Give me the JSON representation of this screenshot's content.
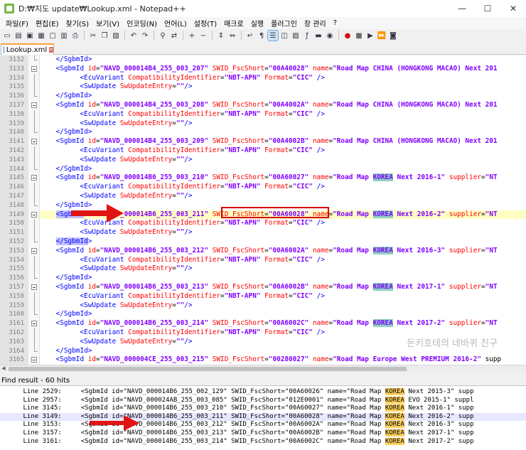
{
  "window": {
    "title": "D:₩지도 update₩Lookup.xml - Notepad++",
    "minimize": "—",
    "maximize": "☐",
    "close": "✕"
  },
  "menu": [
    "파일(F)",
    "편집(E)",
    "찾기(S)",
    "보기(V)",
    "인코딩(N)",
    "언어(L)",
    "설정(T)",
    "매크로",
    "실행",
    "플러그인",
    "창 관리",
    "?"
  ],
  "tab": {
    "label": "Lookup.xml"
  },
  "editor": {
    "lines": [
      {
        "n": "3132",
        "code": "    </SgbmId>"
      },
      {
        "n": "3133",
        "code": "    <SgbmId id=\"NAVD_000014B4_255_003_207\" SWID_FscShort=\"00A40028\" name=\"Road Map CHINA (HONGKONG MACAO) Next 201"
      },
      {
        "n": "3134",
        "code": "          <EcuVariant CompatibilityIdentifier=\"NBT-APN\" Format=\"CIC\" />"
      },
      {
        "n": "3135",
        "code": "          <SwUpdate SwUpdateEntry=\"\"/>"
      },
      {
        "n": "3136",
        "code": "    </SgbmId>"
      },
      {
        "n": "3137",
        "code": "    <SgbmId id=\"NAVD_000014B4_255_003_208\" SWID_FscShort=\"00A4002A\" name=\"Road Map CHINA (HONGKONG MACAO) Next 201"
      },
      {
        "n": "3138",
        "code": "          <EcuVariant CompatibilityIdentifier=\"NBT-APN\" Format=\"CIC\" />"
      },
      {
        "n": "3139",
        "code": "          <SwUpdate SwUpdateEntry=\"\"/>"
      },
      {
        "n": "3140",
        "code": "    </SgbmId>"
      },
      {
        "n": "3141",
        "code": "    <SgbmId id=\"NAVD_000014B4_255_003_209\" SWID_FscShort=\"00A4002B\" name=\"Road Map CHINA (HONGKONG MACAO) Next 201"
      },
      {
        "n": "3142",
        "code": "          <EcuVariant CompatibilityIdentifier=\"NBT-APN\" Format=\"CIC\" />"
      },
      {
        "n": "3143",
        "code": "          <SwUpdate SwUpdateEntry=\"\"/>"
      },
      {
        "n": "3144",
        "code": "    </SgbmId>"
      },
      {
        "n": "3145",
        "code": "    <SgbmId id=\"NAVD_000014B6_255_003_210\" SWID_FscShort=\"00A60027\" name=\"Road Map KOREA Next 2016-1\" supplier=\"NT"
      },
      {
        "n": "3146",
        "code": "          <EcuVariant CompatibilityIdentifier=\"NBT-APN\" Format=\"CIC\" />"
      },
      {
        "n": "3147",
        "code": "          <SwUpdate SwUpdateEntry=\"\"/>"
      },
      {
        "n": "3148",
        "code": "    </SgbmId>"
      },
      {
        "n": "3149",
        "code": "    <SgbmId id=\"NAVD_000014B6_255_003_211\" SWID_FscShort=\"00A60028\" name=\"Road Map KOREA Next 2016-2\" supplier=\"NT"
      },
      {
        "n": "3150",
        "code": "          <EcuVariant CompatibilityIdentifier=\"NBT-APN\" Format=\"CIC\" />"
      },
      {
        "n": "3151",
        "code": "          <SwUpdate SwUpdateEntry=\"\"/>"
      },
      {
        "n": "3152",
        "code": "    </SgbmId>"
      },
      {
        "n": "3153",
        "code": "    <SgbmId id=\"NAVD_000014B6_255_003_212\" SWID_FscShort=\"00A6002A\" name=\"Road Map KOREA Next 2016-3\" supplier=\"NT"
      },
      {
        "n": "3154",
        "code": "          <EcuVariant CompatibilityIdentifier=\"NBT-APN\" Format=\"CIC\" />"
      },
      {
        "n": "3155",
        "code": "          <SwUpdate SwUpdateEntry=\"\"/>"
      },
      {
        "n": "3156",
        "code": "    </SgbmId>"
      },
      {
        "n": "3157",
        "code": "    <SgbmId id=\"NAVD_000014B6_255_003_213\" SWID_FscShort=\"00A6002B\" name=\"Road Map KOREA Next 2017-1\" supplier=\"NT"
      },
      {
        "n": "3158",
        "code": "          <EcuVariant CompatibilityIdentifier=\"NBT-APN\" Format=\"CIC\" />"
      },
      {
        "n": "3159",
        "code": "          <SwUpdate SwUpdateEntry=\"\"/>"
      },
      {
        "n": "3160",
        "code": "    </SgbmId>"
      },
      {
        "n": "3161",
        "code": "    <SgbmId id=\"NAVD_000014B6_255_003_214\" SWID_FscShort=\"00A6002C\" name=\"Road Map KOREA Next 2017-2\" supplier=\"NT"
      },
      {
        "n": "3162",
        "code": "          <EcuVariant CompatibilityIdentifier=\"NBT-APN\" Format=\"CIC\" />"
      },
      {
        "n": "3163",
        "code": "          <SwUpdate SwUpdateEntry=\"\"/>"
      },
      {
        "n": "3164",
        "code": "    </SgbmId>"
      },
      {
        "n": "3165",
        "code": "    <SgbmId id=\"NAVD_000004CE_255_003_215\" SWID_FscShort=\"00280027\" name=\"Road Map Europe West PREMIUM 2016-2\" supp"
      }
    ],
    "current_line": "3149",
    "search_term": "KOREA"
  },
  "watermark": "돈키호테의 네바퀴 친구",
  "find": {
    "header": "Find result - 60 hits",
    "results": [
      {
        "label": "Line 2529:",
        "text": "<SgbmId id=\"NAVD_000014B6_255_002_129\" SWID_FscShort=\"00A60026\" name=\"Road Map KOREA Next 2015-3\" supp"
      },
      {
        "label": "Line 2957:",
        "text": "<SgbmId id=\"NAVD_000024AB_255_003_085\" SWID_FscShort=\"012E0001\" name=\"Road Map KOREA EVO 2015-1\" suppl"
      },
      {
        "label": "Line 3145:",
        "text": "<SgbmId id=\"NAVD_000014B6_255_003_210\" SWID_FscShort=\"00A60027\" name=\"Road Map KOREA Next 2016-1\" supp"
      },
      {
        "label": "Line 3149:",
        "text": "<SgbmId id=\"NAVD_000014B6_255_003_211\" SWID_FscShort=\"00A60028\" name=\"Road Map KOREA Next 2016-2\" supp"
      },
      {
        "label": "Line 3153:",
        "text": "<SgbmId id=\"NAVD_000014B6_255_003_212\" SWID_FscShort=\"00A6002A\" name=\"Road Map KOREA Next 2016-3\" supp"
      },
      {
        "label": "Line 3157:",
        "text": "<SgbmId id=\"NAVD_000014B6_255_003_213\" SWID_FscShort=\"00A6002B\" name=\"Road Map KOREA Next 2017-1\" supp"
      },
      {
        "label": "Line 3161:",
        "text": "<SgbmId id=\"NAVD_000014B6_255_003_214\" SWID_FscShort=\"00A6002C\" name=\"Road Map KOREA Next 2017-2\" supp"
      }
    ],
    "selected_index": 3
  },
  "colors": {
    "tag": "#0000ff",
    "attribute": "#ff0000",
    "value": "#8000ff",
    "korea_highlight": "#8fd3c2",
    "find_highlight": "#ffd05c",
    "annotation_red": "#d60000"
  },
  "toolbar_icons": [
    "new-file-icon",
    "open-file-icon",
    "save-icon",
    "save-all-icon",
    "close-icon",
    "close-all-icon",
    "print-icon",
    "cut-icon",
    "copy-icon",
    "paste-icon",
    "undo-icon",
    "redo-icon",
    "find-icon",
    "replace-icon",
    "zoom-in-icon",
    "zoom-out-icon",
    "sync-v-icon",
    "sync-h-icon",
    "wrap-icon",
    "show-all-icon",
    "indent-guide-icon",
    "udl-icon",
    "doc-map-icon",
    "function-list-icon",
    "folder-icon",
    "monitor-icon",
    "record-icon",
    "stop-icon",
    "play-icon",
    "play-multi-icon",
    "save-macro-icon"
  ]
}
